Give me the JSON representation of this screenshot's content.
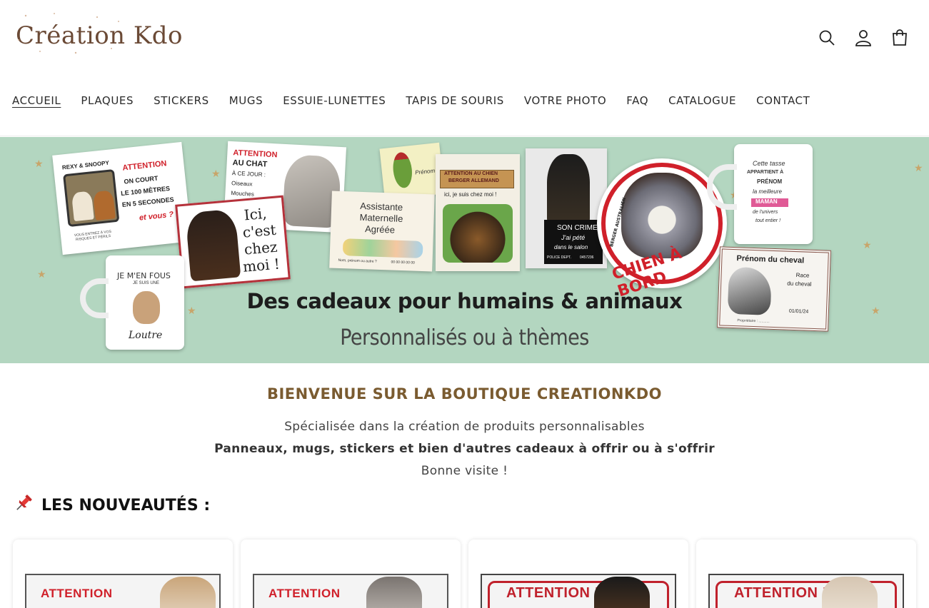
{
  "brand": {
    "logo_text": "Création Kdo",
    "logo_color": "#6b4a36"
  },
  "header_icons": [
    "search-icon",
    "account-icon",
    "cart-icon"
  ],
  "nav": {
    "items": [
      {
        "label": "ACCUEIL",
        "active": true
      },
      {
        "label": "PLAQUES"
      },
      {
        "label": "STICKERS"
      },
      {
        "label": "MUGS"
      },
      {
        "label": "ESSUIE-LUNETTES"
      },
      {
        "label": "TAPIS DE SOURIS"
      },
      {
        "label": "VOTRE PHOTO"
      },
      {
        "label": "FAQ"
      },
      {
        "label": "CATALOGUE"
      },
      {
        "label": "CONTACT"
      }
    ]
  },
  "banner": {
    "title": "Des cadeaux pour humains & animaux",
    "subtitle": "Personnalisés ou à thèmes",
    "background": "#b3d6c0",
    "cards": {
      "rexy": {
        "names": "REXY & SNOOPY",
        "attention": "ATTENTION",
        "line1": "ON COURT",
        "line2": "LE 100 MÈTRES",
        "line3": "EN 5 SECONDES",
        "line4": "et vous ?",
        "footer": "VOUS ENTREZ À VOS RISQUES ET PÉRILS"
      },
      "chat": {
        "attention": "ATTENTION",
        "line1": "AU CHAT",
        "line2": "À CE JOUR :",
        "line3": "Oiseaux",
        "line4": "Mouches"
      },
      "rottweiler": {
        "text1": "Ici,",
        "text2": "c'est",
        "text3": "chez",
        "text4": "moi !"
      },
      "bird": {
        "label": "Prénom"
      },
      "assistante": {
        "line1": "Assistante",
        "line2": "Maternelle",
        "line3": "Agréée",
        "footer": "Nom, prénom ou autre ?",
        "phone": "00 00 00 00 00"
      },
      "berger": {
        "line1": "ATTENTION AU CHIEN",
        "line2": "BERGER ALLEMAND",
        "line3": "ici, je suis chez moi !"
      },
      "mugshot": {
        "line1": "SON CRIME",
        "line2": "J'ai pété",
        "line3": "dans le salon",
        "dept": "POLICE DEPT.",
        "num": "0457236"
      },
      "chien_bord": {
        "text": "CHIEN À BORD",
        "breed": "BERGER AUSTRALIEN"
      },
      "mug_maman": {
        "line1": "Cette tasse",
        "line2": "APPARTIENT À",
        "line3": "PRÉNOM",
        "line4": "la meilleure",
        "line5": "MAMAN",
        "line6": "de l'univers",
        "line7": "tout entier !"
      },
      "mug_loutre": {
        "line1": "JE M'EN FOUS",
        "line2": "JE SUIS UNE",
        "line3": "Loutre"
      },
      "cheval": {
        "line1": "Prénom du cheval",
        "line2": "Race",
        "line3": "du cheval",
        "date": "01/01/24",
        "owner": "Propriétaire : ..........."
      }
    }
  },
  "welcome": {
    "title": "BIENVENUE SUR LA BOUTIQUE CREATIONKDO",
    "line1": "Spécialisée dans la création de produits personnalisables",
    "line2": "Panneaux, mugs, stickers et bien d'autres cadeaux à offrir ou à s'offrir",
    "line3": "Bonne visite !",
    "title_color": "#7a5b30"
  },
  "news": {
    "title": "LES NOUVEAUTÉS :",
    "icon": "pushpin-icon",
    "products": [
      {
        "plate_text": "ATTENTION",
        "style": "plain"
      },
      {
        "plate_text": "ATTENTION",
        "style": "plain"
      },
      {
        "plate_text": "ATTENTION !",
        "style": "framed"
      },
      {
        "plate_text": "ATTENTION !",
        "style": "framed"
      }
    ]
  }
}
